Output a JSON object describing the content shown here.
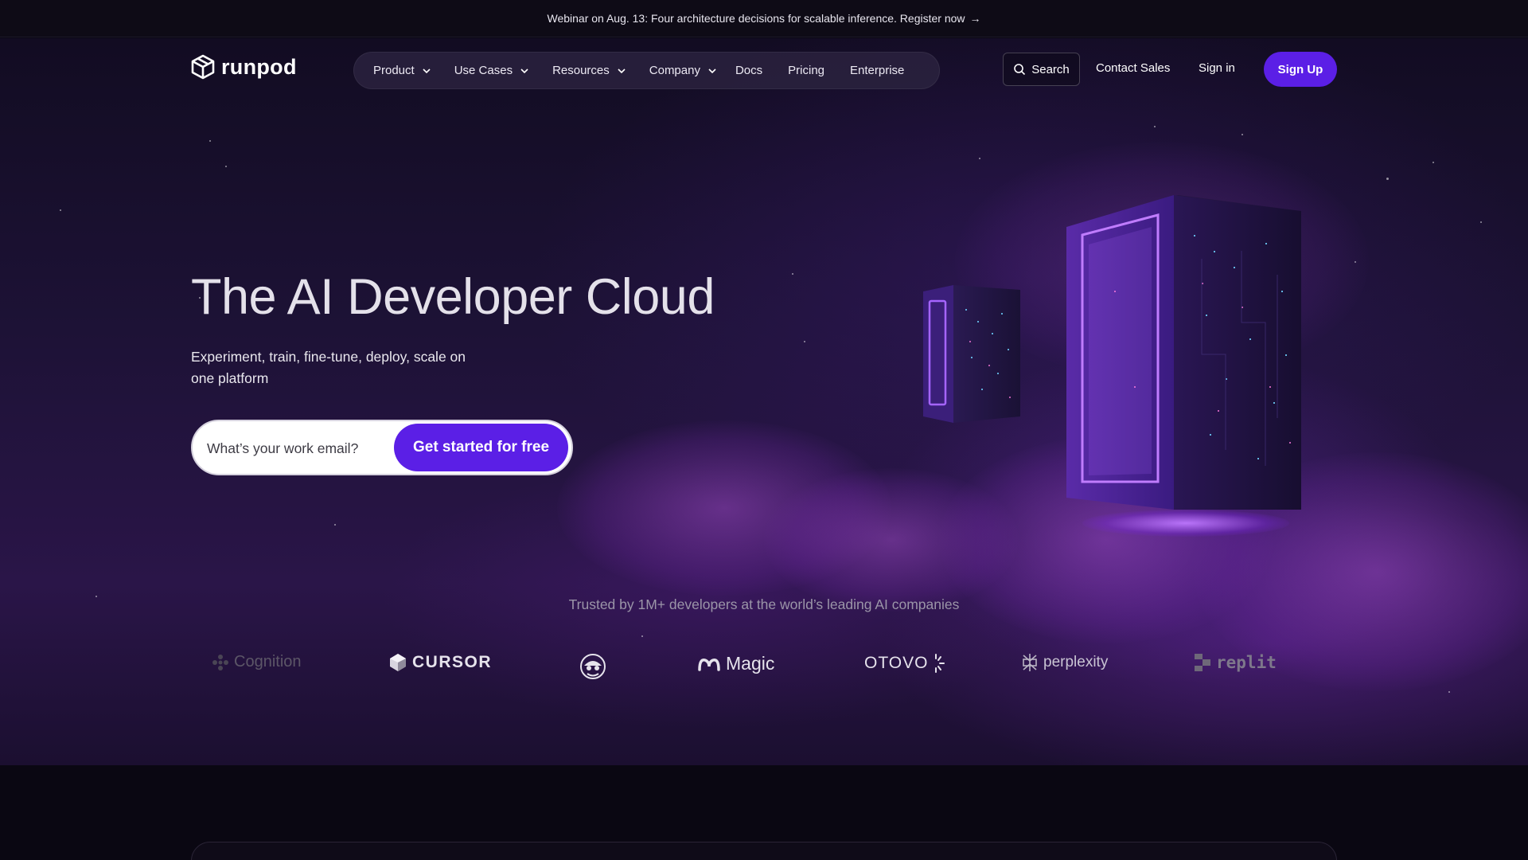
{
  "announcement": {
    "text": "Webinar on Aug. 13: Four architecture decisions for scalable inference. Register now",
    "arrow": "→"
  },
  "brand": {
    "name": "runpod"
  },
  "nav": {
    "items": [
      {
        "label": "Product",
        "has_dropdown": true
      },
      {
        "label": "Use Cases",
        "has_dropdown": true
      },
      {
        "label": "Resources",
        "has_dropdown": true
      },
      {
        "label": "Company",
        "has_dropdown": true
      },
      {
        "label": "Docs",
        "has_dropdown": false
      },
      {
        "label": "Pricing",
        "has_dropdown": false
      },
      {
        "label": "Enterprise",
        "has_dropdown": false
      }
    ],
    "search_label": "Search",
    "contact_sales": "Contact Sales",
    "sign_in": "Sign in",
    "sign_up": "Sign Up"
  },
  "hero": {
    "headline": "The AI Developer Cloud",
    "subhead": "Experiment, train, fine-tune, deploy, scale on one platform",
    "email_placeholder": "What’s your work email?",
    "cta_label": "Get started for free"
  },
  "trusted": {
    "text": "Trusted by 1M+ developers at the world’s leading AI companies",
    "logos": [
      {
        "name": "Cognition",
        "icon": "cognition-logo-icon"
      },
      {
        "name": "CURSOR",
        "icon": "cursor-logo-icon"
      },
      {
        "name": "",
        "icon": "mascot-logo-icon"
      },
      {
        "name": "Magic",
        "icon": "magic-logo-icon"
      },
      {
        "name": "OTOVO",
        "icon": "otovo-sunburst-icon"
      },
      {
        "name": "perplexity",
        "icon": "perplexity-logo-icon"
      },
      {
        "name": "replit",
        "icon": "replit-logo-icon"
      }
    ]
  },
  "colors": {
    "accent": "#5b1fe6",
    "background": "#0a0712",
    "hero_purple": "#2a1548"
  }
}
